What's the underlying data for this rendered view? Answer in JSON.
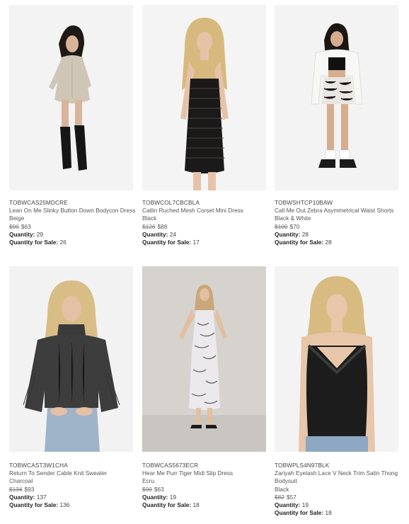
{
  "products": [
    {
      "sku": "TOBWCAS25MDCRE",
      "name": "Lean On Me Slinky Button Down Bodycon Dress",
      "color": "Beige",
      "old_price": "$90",
      "price": "$63",
      "quantity": "29",
      "quantity_for_sale": "26"
    },
    {
      "sku": "TOBWCOL7CBCBLA",
      "name": "Catlin Ruched Mesh Corset Mini Dress",
      "color": "Black",
      "old_price": "$126",
      "price": "$88",
      "quantity": "24",
      "quantity_for_sale": "17"
    },
    {
      "sku": "TOBWSHTCP10BAW",
      "name": "Call Me Out Zebra Asymmetrical Waist Shorts",
      "color": "Black & White",
      "old_price": "$100",
      "price": "$70",
      "quantity": "28",
      "quantity_for_sale": "28"
    },
    {
      "sku": "TOBWCAST3W1CHA",
      "name": "Return To Sender Cable Knit Sweater",
      "color": "Charcoal",
      "old_price": "$134",
      "price": "$93",
      "quantity": "137",
      "quantity_for_sale": "136"
    },
    {
      "sku": "TOBWCAS5673ECR",
      "name": "Hear Me Purr Tiger Midi Slip Dress",
      "color": "Ecru",
      "old_price": "$90",
      "price": "$63",
      "quantity": "19",
      "quantity_for_sale": "18"
    },
    {
      "sku": "TOBWPLS4N97BLK",
      "name": "Zariyah Eyelash Lace V Neck Trim Satin Thong",
      "name_line2": "Bodysuit",
      "color": "Black",
      "old_price": "$82",
      "price": "$57",
      "quantity": "19",
      "quantity_for_sale": "18"
    }
  ],
  "labels": {
    "quantity": "Quantity:",
    "quantity_for_sale": "Quantity for Sale:"
  },
  "colors": {
    "photo_bg": "#f2f2f2",
    "sweater": "#3c3c3c",
    "slip_bg": "#dcd9d6"
  }
}
